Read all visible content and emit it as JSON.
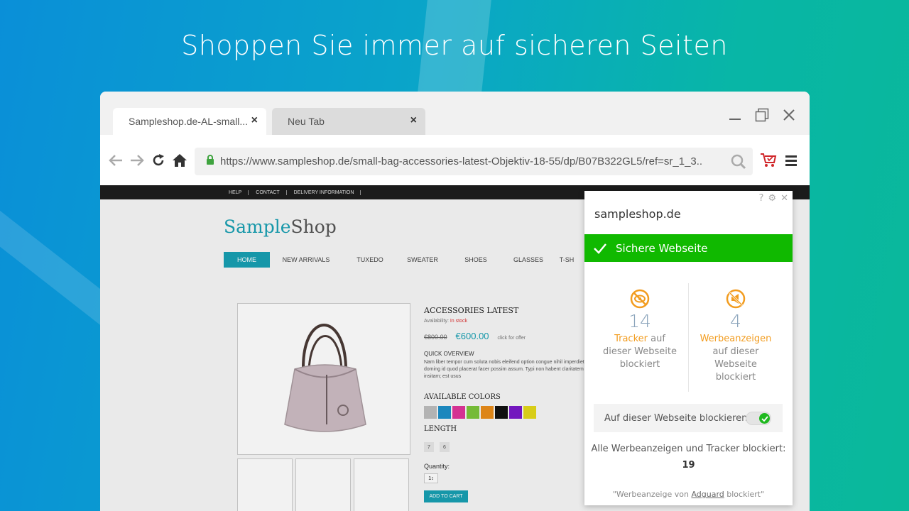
{
  "headline": "Shoppen Sie immer auf sicheren Seiten",
  "browser": {
    "tabs": [
      {
        "label": "Sampleshop.de-AL-small...",
        "close": "×"
      },
      {
        "label": "Neu Tab",
        "close": "×"
      }
    ],
    "url": "https://www.sampleshop.de/small-bag-accessories-latest-Objektiv-18-55/dp/B07B322GL5/ref=sr_1_3.."
  },
  "shop": {
    "topbar": [
      "HELP",
      "CONTACT",
      "DELIVERY INFORMATION"
    ],
    "logo_a": "Sample",
    "logo_b": "Shop",
    "menu": [
      "HOME",
      "NEW ARRIVALS",
      "TUXEDO",
      "SWEATER",
      "SHOES",
      "GLASSES",
      "T-SH"
    ],
    "product_title": "ACCESSORIES LATEST",
    "availability_label": "Availability:",
    "availability_status": "In stock",
    "old_price": "€800.00",
    "new_price": "€600.00",
    "offer": "click for offer",
    "quick_overview": "QUICK OVERVIEW",
    "description": "Nam liber tempor cum soluta nobis eleifend option congue nihil imperdiet doming id quod placerat facer possim assum. Typi non habent claritatem insitam; est usus",
    "colors_label": "AVAILABLE COLORS",
    "swatches": [
      "#bdbdbd",
      "#1e8fc8",
      "#e0359a",
      "#7cc63a",
      "#e98d1a",
      "#111111",
      "#7a19c9",
      "#e4d81a"
    ],
    "length_label": "LENGTH",
    "lengths": [
      "7",
      "6"
    ],
    "quantity_label": "Quantity:",
    "quantity": "1",
    "add_to_cart": "ADD TO CART"
  },
  "popup": {
    "domain": "sampleshop.de",
    "status": "Sichere Webseite",
    "trackers": {
      "count": "14",
      "highlight": "Tracker",
      "rest1": "auf",
      "rest2": "dieser Webseite",
      "rest3": "blockiert"
    },
    "ads": {
      "count": "4",
      "highlight": "Werbeanzeigen",
      "rest1": "auf dieser",
      "rest2": "Webseite",
      "rest3": "blockiert"
    },
    "toggle_label": "Auf dieser Webseite blockieren",
    "toggle_on": true,
    "all_blocked_label": "Alle Werbeanzeigen und Tracker blockiert:",
    "all_blocked_count": "19",
    "footer_pre": "\"Werbeanzeige von ",
    "footer_link": "Adguard",
    "footer_post": " blockiert\""
  },
  "colors": {
    "accent_green": "#10b900",
    "accent_orange": "#f29c1f",
    "shop_teal": "#18a0b3"
  }
}
